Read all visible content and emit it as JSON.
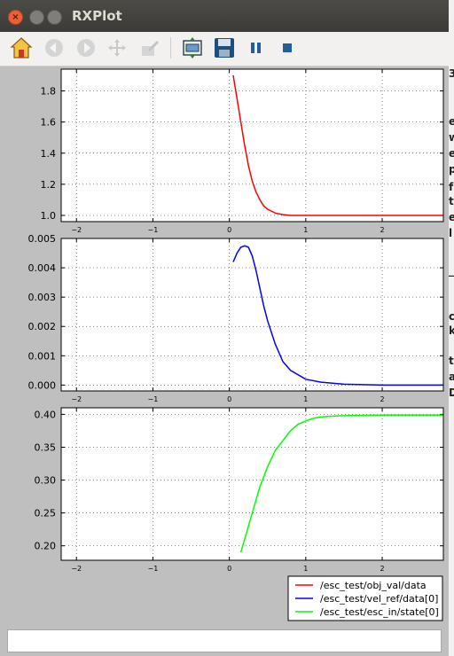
{
  "window": {
    "title": "RXPlot"
  },
  "toolbar": {
    "buttons": [
      {
        "name": "home-icon"
      },
      {
        "name": "back-icon"
      },
      {
        "name": "forward-icon"
      },
      {
        "name": "pan-icon"
      },
      {
        "name": "zoom-icon"
      },
      {
        "name": "subplots-icon"
      },
      {
        "name": "save-icon"
      },
      {
        "name": "pause-icon"
      },
      {
        "name": "stop-icon"
      }
    ]
  },
  "colors": {
    "red": "#ff0000",
    "blue": "#0000ff",
    "green": "#00ff00"
  },
  "chart_data": [
    {
      "type": "line",
      "title": "",
      "xlim": [
        -2.2,
        2.8
      ],
      "ylim": [
        0.96,
        1.94
      ],
      "xticks": [
        "-2",
        "-1",
        "0",
        "1",
        "2"
      ],
      "yticks": [
        "1.0",
        "1.2",
        "1.4",
        "1.6",
        "1.8"
      ],
      "grid": true,
      "series": [
        {
          "name": "/esc_test/obj_val/data",
          "color": "#ff0000",
          "x": [
            0.05,
            0.1,
            0.15,
            0.2,
            0.25,
            0.3,
            0.35,
            0.4,
            0.45,
            0.5,
            0.6,
            0.7,
            0.8,
            1.0,
            1.5,
            2.0,
            2.8
          ],
          "y": [
            1.9,
            1.75,
            1.6,
            1.45,
            1.32,
            1.22,
            1.15,
            1.1,
            1.06,
            1.04,
            1.015,
            1.005,
            1.0,
            1.0,
            1.0,
            1.0,
            1.0
          ]
        }
      ]
    },
    {
      "type": "line",
      "title": "",
      "xlim": [
        -2.2,
        2.8
      ],
      "ylim": [
        -0.0002,
        0.005
      ],
      "xticks": [
        "-2",
        "-1",
        "0",
        "1",
        "2"
      ],
      "yticks": [
        "0.000",
        "0.001",
        "0.002",
        "0.003",
        "0.004",
        "0.005"
      ],
      "grid": true,
      "series": [
        {
          "name": "/esc_test/vel_ref/data[0]",
          "color": "#0000ff",
          "x": [
            0.05,
            0.1,
            0.15,
            0.2,
            0.25,
            0.3,
            0.35,
            0.4,
            0.45,
            0.5,
            0.6,
            0.7,
            0.8,
            1.0,
            1.2,
            1.5,
            2.0,
            2.8
          ],
          "y": [
            0.0042,
            0.0045,
            0.0047,
            0.00475,
            0.0047,
            0.0044,
            0.0039,
            0.0033,
            0.0027,
            0.0022,
            0.0014,
            0.0008,
            0.0005,
            0.0002,
            0.0001,
            3e-05,
            0.0,
            0.0
          ]
        }
      ]
    },
    {
      "type": "line",
      "title": "",
      "xlim": [
        -2.2,
        2.8
      ],
      "ylim": [
        0.178,
        0.41
      ],
      "xticks": [
        "-2",
        "-1",
        "0",
        "1",
        "2"
      ],
      "yticks": [
        "0.20",
        "0.25",
        "0.30",
        "0.35",
        "0.40"
      ],
      "grid": true,
      "series": [
        {
          "name": "/esc_test/esc_in/state[0]",
          "color": "#00ff00",
          "x": [
            0.15,
            0.2,
            0.3,
            0.4,
            0.5,
            0.6,
            0.7,
            0.8,
            0.9,
            1.0,
            1.1,
            1.2,
            1.3,
            1.5,
            2.0,
            2.8
          ],
          "y": [
            0.19,
            0.21,
            0.25,
            0.29,
            0.32,
            0.345,
            0.36,
            0.375,
            0.385,
            0.39,
            0.394,
            0.396,
            0.397,
            0.398,
            0.399,
            0.399
          ]
        }
      ]
    }
  ],
  "legend": {
    "placement": "bottom-right",
    "entries": [
      {
        "label": "/esc_test/obj_val/data",
        "color": "#ff0000"
      },
      {
        "label": "/esc_test/vel_ref/data[0]",
        "color": "#0000ff"
      },
      {
        "label": "/esc_test/esc_in/state[0]",
        "color": "#00ff00"
      }
    ]
  },
  "statusbar": {
    "text": ""
  },
  "background_window": {
    "fragments": [
      "3",
      "e",
      "w",
      "e",
      "p",
      "f",
      "t",
      "e",
      "l",
      "_",
      "c",
      "k",
      "t",
      "a",
      "D"
    ]
  }
}
